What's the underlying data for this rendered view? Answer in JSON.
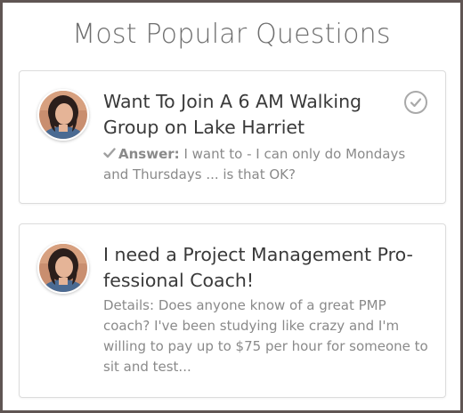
{
  "page": {
    "heading": "Most Popular Questions"
  },
  "questions": [
    {
      "title": "Want To Join A 6 AM Walking Group on Lake Harriet",
      "answer_label": "Answer:",
      "answer_text": "I want to - I can only do Mondays and Thursdays ... is that OK?",
      "answered": true,
      "icon": "check-circle-icon"
    },
    {
      "title": "I need a Project Management Pro-fessional Coach!",
      "details_text": "Details: Does anyone know of a great PMP coach? I've been studying like crazy and I'm willing to pay up to $75 per hour for someone to sit and test..."
    }
  ],
  "colors": {
    "border": "#5f5553",
    "card_border": "#dcdcdc",
    "title": "#3a3a3a",
    "muted_text": "#8a8a8a",
    "heading": "#6d6d6d"
  }
}
